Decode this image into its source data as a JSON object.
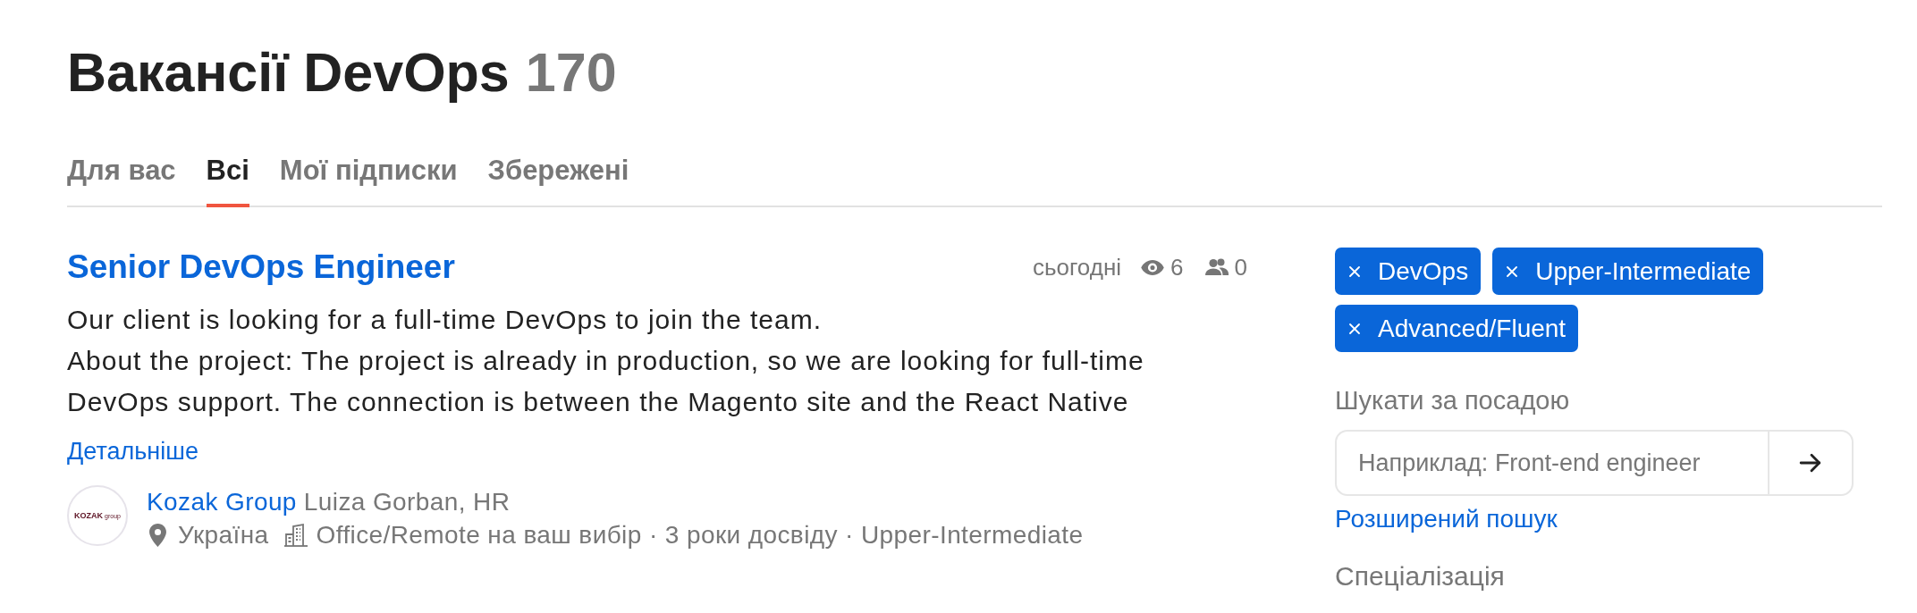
{
  "header": {
    "title": "Вакансії DevOps",
    "count": "170"
  },
  "tabs": [
    {
      "label": "Для вас",
      "selected": false
    },
    {
      "label": "Всі",
      "selected": true
    },
    {
      "label": "Мої підписки",
      "selected": false
    },
    {
      "label": "Збережені",
      "selected": false
    }
  ],
  "jobs": [
    {
      "title": "Senior DevOps Engineer",
      "posted": "сьогодні",
      "views": "6",
      "applicants": "0",
      "description": [
        "Our client is looking for a full-time DevOps to join the team.",
        "About the project: The project is already in production, so we are looking for full-time DevOps support. The connection is between the Magento site and the React Native"
      ],
      "more_link": "Детальніше",
      "company": {
        "name": "Kozak Group",
        "logo_wordmark": "KOZAK",
        "logo_subtext": "group"
      },
      "recruiter": "Luiza Gorban, HR",
      "location": "Україна",
      "details": "Office/Remote на ваш вибір · 3 роки досвіду · Upper-Intermediate"
    }
  ],
  "filters": {
    "tags": [
      {
        "label": "DevOps"
      },
      {
        "label": "Upper-Intermediate"
      },
      {
        "label": "Advanced/Fluent"
      }
    ],
    "search_label": "Шукати за посадою",
    "search": {
      "placeholder": "Наприклад: Front-end engineer"
    },
    "advanced_link": "Розширений пошук",
    "section_heading": "Спеціалізація"
  }
}
